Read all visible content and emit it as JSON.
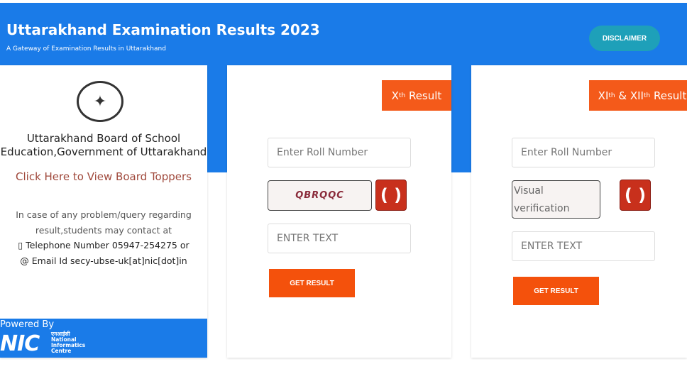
{
  "header": {
    "title": "Uttarakhand Examination Results 2023",
    "subtitle": "A Gateway of Examination Results in Uttarakhand",
    "disclaimer": "DISCLAIMER"
  },
  "left": {
    "board_line1": "Uttarakhand Board of School",
    "board_line2": "Education,Government of Uttarakhand",
    "toppers_link": "Click Here to View Board Toppers",
    "contact_line1": "In case of any problem/query regarding",
    "contact_line2": "result,students may contact at",
    "phone": "Telephone Number 05947-254275 or",
    "email": "Email Id secy-ubse-uk[at]nic[dot]in",
    "powered_by": "Powered By",
    "nic": "NIC",
    "nic_hindi": "एनआईसी",
    "nic_l1": "National",
    "nic_l2": "Informatics",
    "nic_l3": "Centre"
  },
  "x_result": {
    "title_base": "X",
    "title_sup": "th",
    "title_rest": " Result",
    "roll_placeholder": "Enter Roll Number",
    "captcha_text": "QBRQQC",
    "text_placeholder": "ENTER TEXT",
    "button": "GET RESULT"
  },
  "xii_result": {
    "t1": "XI",
    "s1": "th",
    "t2": " & XII",
    "s2": "th",
    "t3": " Result",
    "roll_placeholder": "Enter Roll Number",
    "captcha_alt": "Visual verification",
    "text_placeholder": "ENTER TEXT",
    "button": "GET RESULT"
  }
}
